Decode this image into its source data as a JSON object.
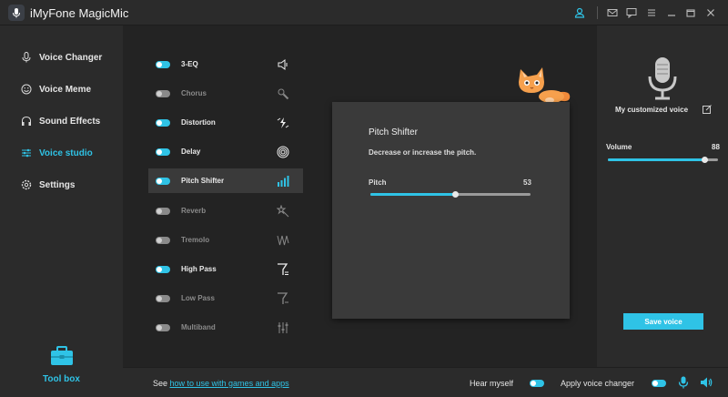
{
  "app": {
    "title": "iMyFone MagicMic",
    "accent_color": "#2fc3e6"
  },
  "titlebar_icons": [
    "user-icon",
    "mail-icon",
    "feedback-icon",
    "minimize-icon",
    "maximize-icon",
    "close-icon"
  ],
  "sidebar": {
    "items": [
      {
        "label": "Voice Changer",
        "icon": "microphone-icon",
        "active": false
      },
      {
        "label": "Voice Meme",
        "icon": "smiley-icon",
        "active": false
      },
      {
        "label": "Sound Effects",
        "icon": "headphones-icon",
        "active": false
      },
      {
        "label": "Voice studio",
        "icon": "sliders-icon",
        "active": true
      },
      {
        "label": "Settings",
        "icon": "gear-icon",
        "active": false
      }
    ],
    "toolbox_label": "Tool box"
  },
  "effects": [
    {
      "label": "3-EQ",
      "enabled": true,
      "icon": "speaker-icon"
    },
    {
      "label": "Chorus",
      "enabled": false,
      "icon": "magnifier-icon"
    },
    {
      "label": "Distortion",
      "enabled": true,
      "icon": "lightning-icon"
    },
    {
      "label": "Delay",
      "enabled": true,
      "icon": "spiral-icon"
    },
    {
      "label": "Pitch Shifter",
      "enabled": true,
      "icon": "bars-icon",
      "selected": true
    },
    {
      "label": "Reverb",
      "enabled": false,
      "icon": "star-wand-icon"
    },
    {
      "label": "Tremolo",
      "enabled": false,
      "icon": "wave-icon"
    },
    {
      "label": "High Pass",
      "enabled": true,
      "icon": "highpass-filter-icon"
    },
    {
      "label": "Low Pass",
      "enabled": false,
      "icon": "lowpass-filter-icon"
    },
    {
      "label": "Multiband",
      "enabled": false,
      "icon": "equalizer-icon"
    }
  ],
  "card": {
    "title": "Pitch Shifter",
    "description": "Decrease or increase the pitch.",
    "pitch_label": "Pitch",
    "pitch_value": "53",
    "pitch_fraction": 0.53
  },
  "right_panel": {
    "custom_voice_label": "My customized voice",
    "volume_label": "Volume",
    "volume_value": "88",
    "volume_fraction": 0.88,
    "save_label": "Save voice"
  },
  "bottombar": {
    "see_text": "See ",
    "link_text": "how to use with games and apps",
    "hear_myself_label": "Hear myself",
    "hear_myself_on": true,
    "apply_label": "Apply voice changer",
    "apply_on": true
  }
}
